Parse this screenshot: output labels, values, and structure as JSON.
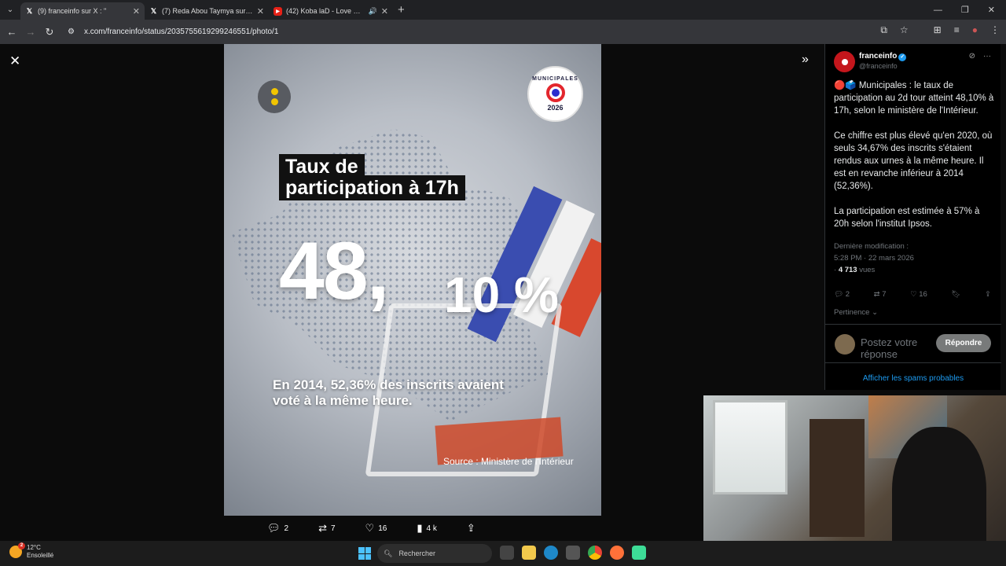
{
  "browser": {
    "tabs": [
      {
        "label": "(9) franceinfo sur X : \"",
        "icon": "x-logo-icon",
        "active": true
      },
      {
        "label": "(7) Reda Abou Taymya sur X : \"",
        "icon": "x-logo-icon",
        "active": false
      },
      {
        "label": "(42) Koba laD - Love Exclu",
        "icon": "youtube-icon",
        "active": false
      }
    ],
    "url": "x.com/franceinfo/status/2035755619299246551/photo/1"
  },
  "photo": {
    "badge": {
      "top": "MUNICIPALES",
      "year": "2026"
    },
    "title_line1": "Taux de",
    "title_line2": "participation à 17h",
    "big_integer": "48,",
    "big_decimal": "10 %",
    "subline": "En 2014, 52,36% des inscrits avaient voté à la même heure.",
    "source": "Source : Ministère de l'Intérieur"
  },
  "photo_actions": {
    "replies": "2",
    "reposts": "7",
    "likes": "16",
    "views": "4 k"
  },
  "tweet": {
    "author": "franceinfo",
    "handle": "@franceinfo",
    "paragraphs": [
      "🔴🗳️ Municipales : le taux de participation au 2d tour atteint 48,10% à 17h, selon le ministère de l'Intérieur.",
      "Ce chiffre est plus élevé qu'en 2020, où seuls 34,67% des inscrits s'étaient rendus aux urnes à la même heure. Il est en revanche inférieur à 2014 (52,36%).",
      "La participation est estimée à 57% à 20h selon l'institut Ipsos."
    ],
    "modified_label": "Dernière modification :",
    "datetime": "5:28 PM · 22 mars 2026",
    "views_count": "4 713",
    "views_label": "vues",
    "replies": "2",
    "reposts": "7",
    "likes": "16",
    "sort_label": "Pertinence",
    "reply_placeholder": "Postez votre réponse",
    "reply_button": "Répondre",
    "spam_link": "Afficher les spams probables"
  },
  "taskbar": {
    "temperature": "12°C",
    "condition": "Ensoleillé",
    "search_placeholder": "Rechercher",
    "weather_badge": "2"
  },
  "colors": {
    "brand_red": "#c4161c",
    "accent_blue": "#1d9bf0",
    "badge_red": "#e3262d"
  }
}
